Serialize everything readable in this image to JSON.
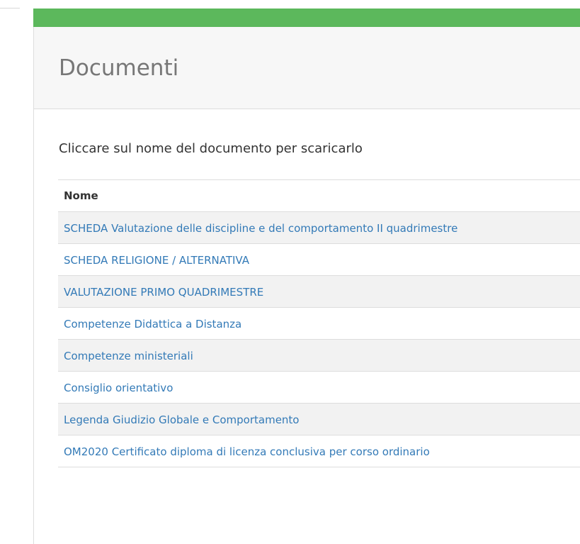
{
  "page": {
    "title": "Documenti",
    "instructions": "Cliccare sul nome del documento per scaricarlo"
  },
  "table": {
    "header": "Nome",
    "documents": [
      "SCHEDA Valutazione delle discipline e del comportamento II quadrimestre",
      "SCHEDA RELIGIONE / ALTERNATIVA",
      "VALUTAZIONE PRIMO QUADRIMESTRE",
      "Competenze Didattica a Distanza",
      "Competenze ministeriali",
      "Consiglio orientativo",
      "Legenda Giudizio Globale e Comportamento",
      "OM2020 Certificato diploma di licenza conclusiva per corso ordinario"
    ]
  },
  "colors": {
    "header_bar": "#5cb85c",
    "link": "#337ab7",
    "striped_row": "#f2f2f2"
  }
}
